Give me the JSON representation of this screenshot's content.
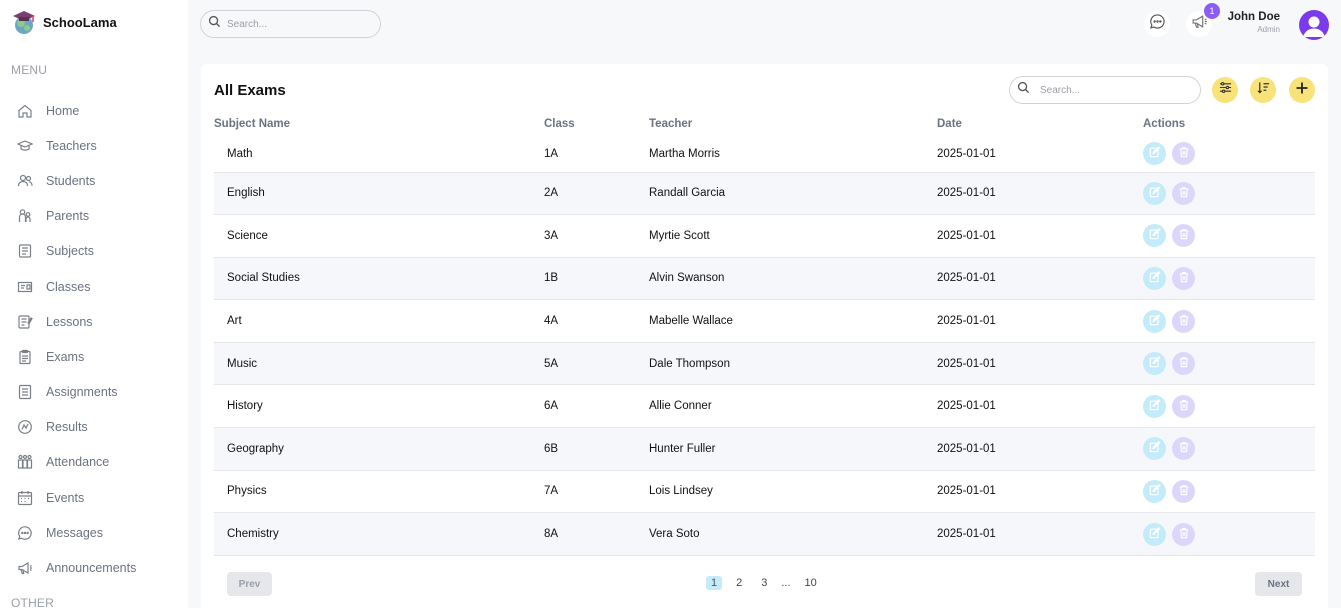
{
  "app": {
    "name": "SchooLama"
  },
  "sidebar": {
    "menu_title": "MENU",
    "other_title": "OTHER",
    "items": [
      {
        "label": "Home",
        "icon": "home-icon"
      },
      {
        "label": "Teachers",
        "icon": "graduation-cap-icon"
      },
      {
        "label": "Students",
        "icon": "students-icon"
      },
      {
        "label": "Parents",
        "icon": "parents-icon"
      },
      {
        "label": "Subjects",
        "icon": "subjects-icon"
      },
      {
        "label": "Classes",
        "icon": "classes-icon"
      },
      {
        "label": "Lessons",
        "icon": "lessons-icon"
      },
      {
        "label": "Exams",
        "icon": "exams-icon"
      },
      {
        "label": "Assignments",
        "icon": "assignments-icon"
      },
      {
        "label": "Results",
        "icon": "results-icon"
      },
      {
        "label": "Attendance",
        "icon": "attendance-icon"
      },
      {
        "label": "Events",
        "icon": "calendar-icon"
      },
      {
        "label": "Messages",
        "icon": "message-icon"
      },
      {
        "label": "Announcements",
        "icon": "megaphone-icon"
      }
    ]
  },
  "topbar": {
    "search_placeholder": "Search...",
    "announcement_badge": "1",
    "user_name": "John Doe",
    "user_role": "Admin"
  },
  "main": {
    "title": "All Exams",
    "search_placeholder": "Search...",
    "columns": [
      "Subject Name",
      "Class",
      "Teacher",
      "Date",
      "Actions"
    ],
    "rows": [
      {
        "subject": "Math",
        "class": "1A",
        "teacher": "Martha Morris",
        "date": "2025-01-01"
      },
      {
        "subject": "English",
        "class": "2A",
        "teacher": "Randall Garcia",
        "date": "2025-01-01"
      },
      {
        "subject": "Science",
        "class": "3A",
        "teacher": "Myrtie Scott",
        "date": "2025-01-01"
      },
      {
        "subject": "Social Studies",
        "class": "1B",
        "teacher": "Alvin Swanson",
        "date": "2025-01-01"
      },
      {
        "subject": "Art",
        "class": "4A",
        "teacher": "Mabelle Wallace",
        "date": "2025-01-01"
      },
      {
        "subject": "Music",
        "class": "5A",
        "teacher": "Dale Thompson",
        "date": "2025-01-01"
      },
      {
        "subject": "History",
        "class": "6A",
        "teacher": "Allie Conner",
        "date": "2025-01-01"
      },
      {
        "subject": "Geography",
        "class": "6B",
        "teacher": "Hunter Fuller",
        "date": "2025-01-01"
      },
      {
        "subject": "Physics",
        "class": "7A",
        "teacher": "Lois Lindsey",
        "date": "2025-01-01"
      },
      {
        "subject": "Chemistry",
        "class": "8A",
        "teacher": "Vera Soto",
        "date": "2025-01-01"
      }
    ],
    "pagination": {
      "prev": "Prev",
      "next": "Next",
      "pages": [
        "1",
        "2",
        "3",
        "...",
        "10"
      ],
      "current": "1"
    }
  },
  "colors": {
    "accent_yellow": "#f8e37a",
    "edit_blue": "#c3ebfa",
    "delete_purple": "#dcd7fa",
    "badge_purple": "#8b5cf6"
  }
}
